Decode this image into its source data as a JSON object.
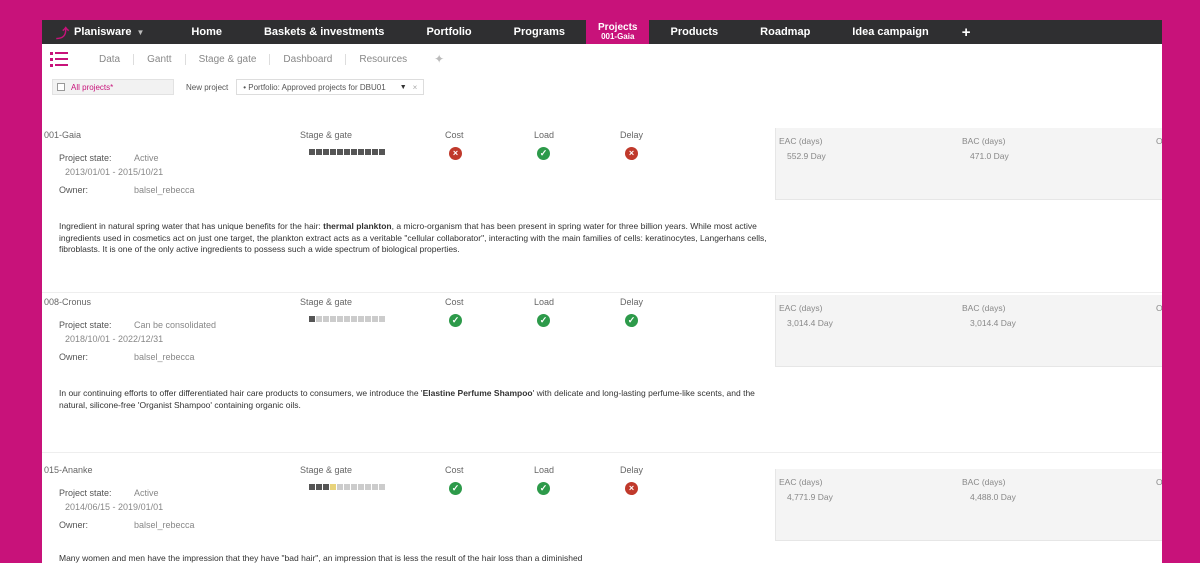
{
  "nav": {
    "brand": "Planisware",
    "items": [
      "Home",
      "Baskets & investments",
      "Portfolio",
      "Programs"
    ],
    "active": {
      "label": "Projects",
      "sub": "001-Gaia"
    },
    "items_after": [
      "Products",
      "Roadmap",
      "Idea campaign"
    ],
    "plus": "+"
  },
  "subtabs": [
    "Data",
    "Gantt",
    "Stage & gate",
    "Dashboard",
    "Resources"
  ],
  "filter": {
    "all_projects": "All projects*",
    "new_project": "New project",
    "portfolio": "• Portfolio: Approved projects for DBU01"
  },
  "columns": {
    "stage_gate": "Stage & gate",
    "cost": "Cost",
    "load": "Load",
    "delay": "Delay",
    "eac": "EAC (days)",
    "bac": "BAC (days)",
    "overflow": "O"
  },
  "labels": {
    "project_state": "Project state:",
    "owner": "Owner:"
  },
  "projects": [
    {
      "id": "001-Gaia",
      "state": "Active",
      "dates": "2013/01/01 - 2015/10/21",
      "owner": "balsel_rebecca",
      "cost": "bad",
      "load": "ok",
      "delay": "bad",
      "eac": "552.9 Day",
      "bac": "471.0 Day",
      "desc_pre": "Ingredient in natural spring water that has unique benefits for the hair: ",
      "desc_bold": "thermal plankton",
      "desc_post": ", a micro-organism that has been present in spring water for three billion years. While most active ingredients used in cosmetics act on just one target, the plankton extract acts as a veritable \"cellular collaborator\", interacting with the main families of cells: keratinocytes, Langerhans cells, fibroblasts. It is one of the only active ingredients to possess such a wide spectrum of biological properties."
    },
    {
      "id": "008-Cronus",
      "state": "Can be consolidated",
      "dates": "2018/10/01 - 2022/12/31",
      "owner": "balsel_rebecca",
      "cost": "ok",
      "load": "ok",
      "delay": "ok",
      "eac": "3,014.4 Day",
      "bac": "3,014.4 Day",
      "desc_pre": "In our continuing efforts to offer differentiated hair care products to consumers, we introduce the '",
      "desc_bold": "Elastine Perfume Shampoo",
      "desc_post": "' with delicate and long-lasting perfume-like scents, and the natural, silicone-free 'Organist Shampoo' containing organic oils."
    },
    {
      "id": "015-Ananke",
      "state": "Active",
      "dates": "2014/06/15 - 2019/01/01",
      "owner": "balsel_rebecca",
      "cost": "ok",
      "load": "ok",
      "delay": "bad",
      "eac": "4,771.9 Day",
      "bac": "4,488.0 Day",
      "desc_pre": "Many women and men have the impression that they have \"bad hair\", an impression that is less the result of the hair loss than a diminished",
      "desc_bold": "",
      "desc_post": ""
    }
  ]
}
